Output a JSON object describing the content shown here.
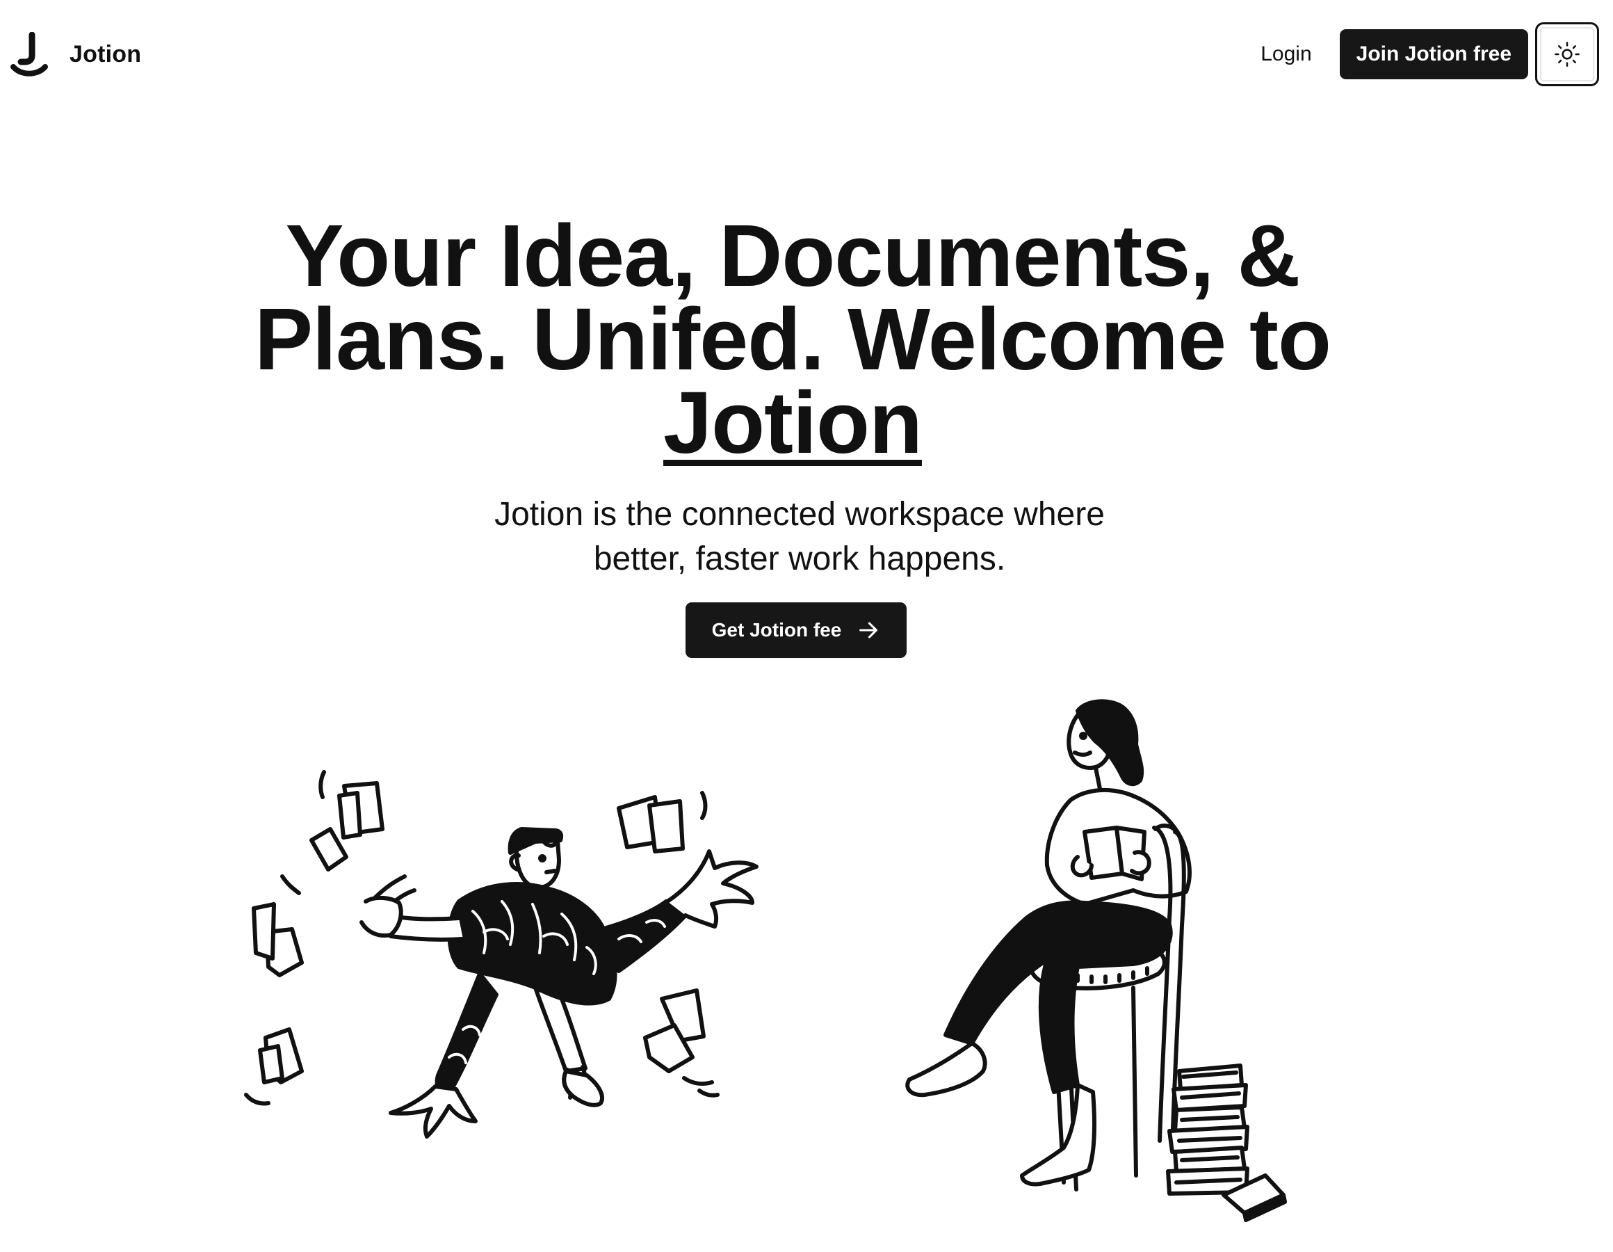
{
  "header": {
    "brand_name": "Jotion",
    "brand_icon": "jotion-logo-icon",
    "login_label": "Login",
    "join_label": "Join Jotion free",
    "theme_icon": "sun-icon"
  },
  "hero": {
    "title_line1": "Your Idea, Documents, &",
    "title_line2": "Plans. Unifed. Welcome to",
    "title_brand": "Jotion",
    "subtitle_line1": "Jotion is the connected workspace where",
    "subtitle_line2": "better, faster work happens.",
    "cta_label": "Get Jotion fee",
    "cta_icon": "arrow-right-icon"
  },
  "illustrations": [
    {
      "name": "illustration-man-throwing-papers"
    },
    {
      "name": "illustration-woman-reading-on-chair"
    }
  ],
  "colors": {
    "background": "#ffffff",
    "text": "#111111",
    "button_bg": "#171717",
    "button_text": "#ffffff"
  }
}
